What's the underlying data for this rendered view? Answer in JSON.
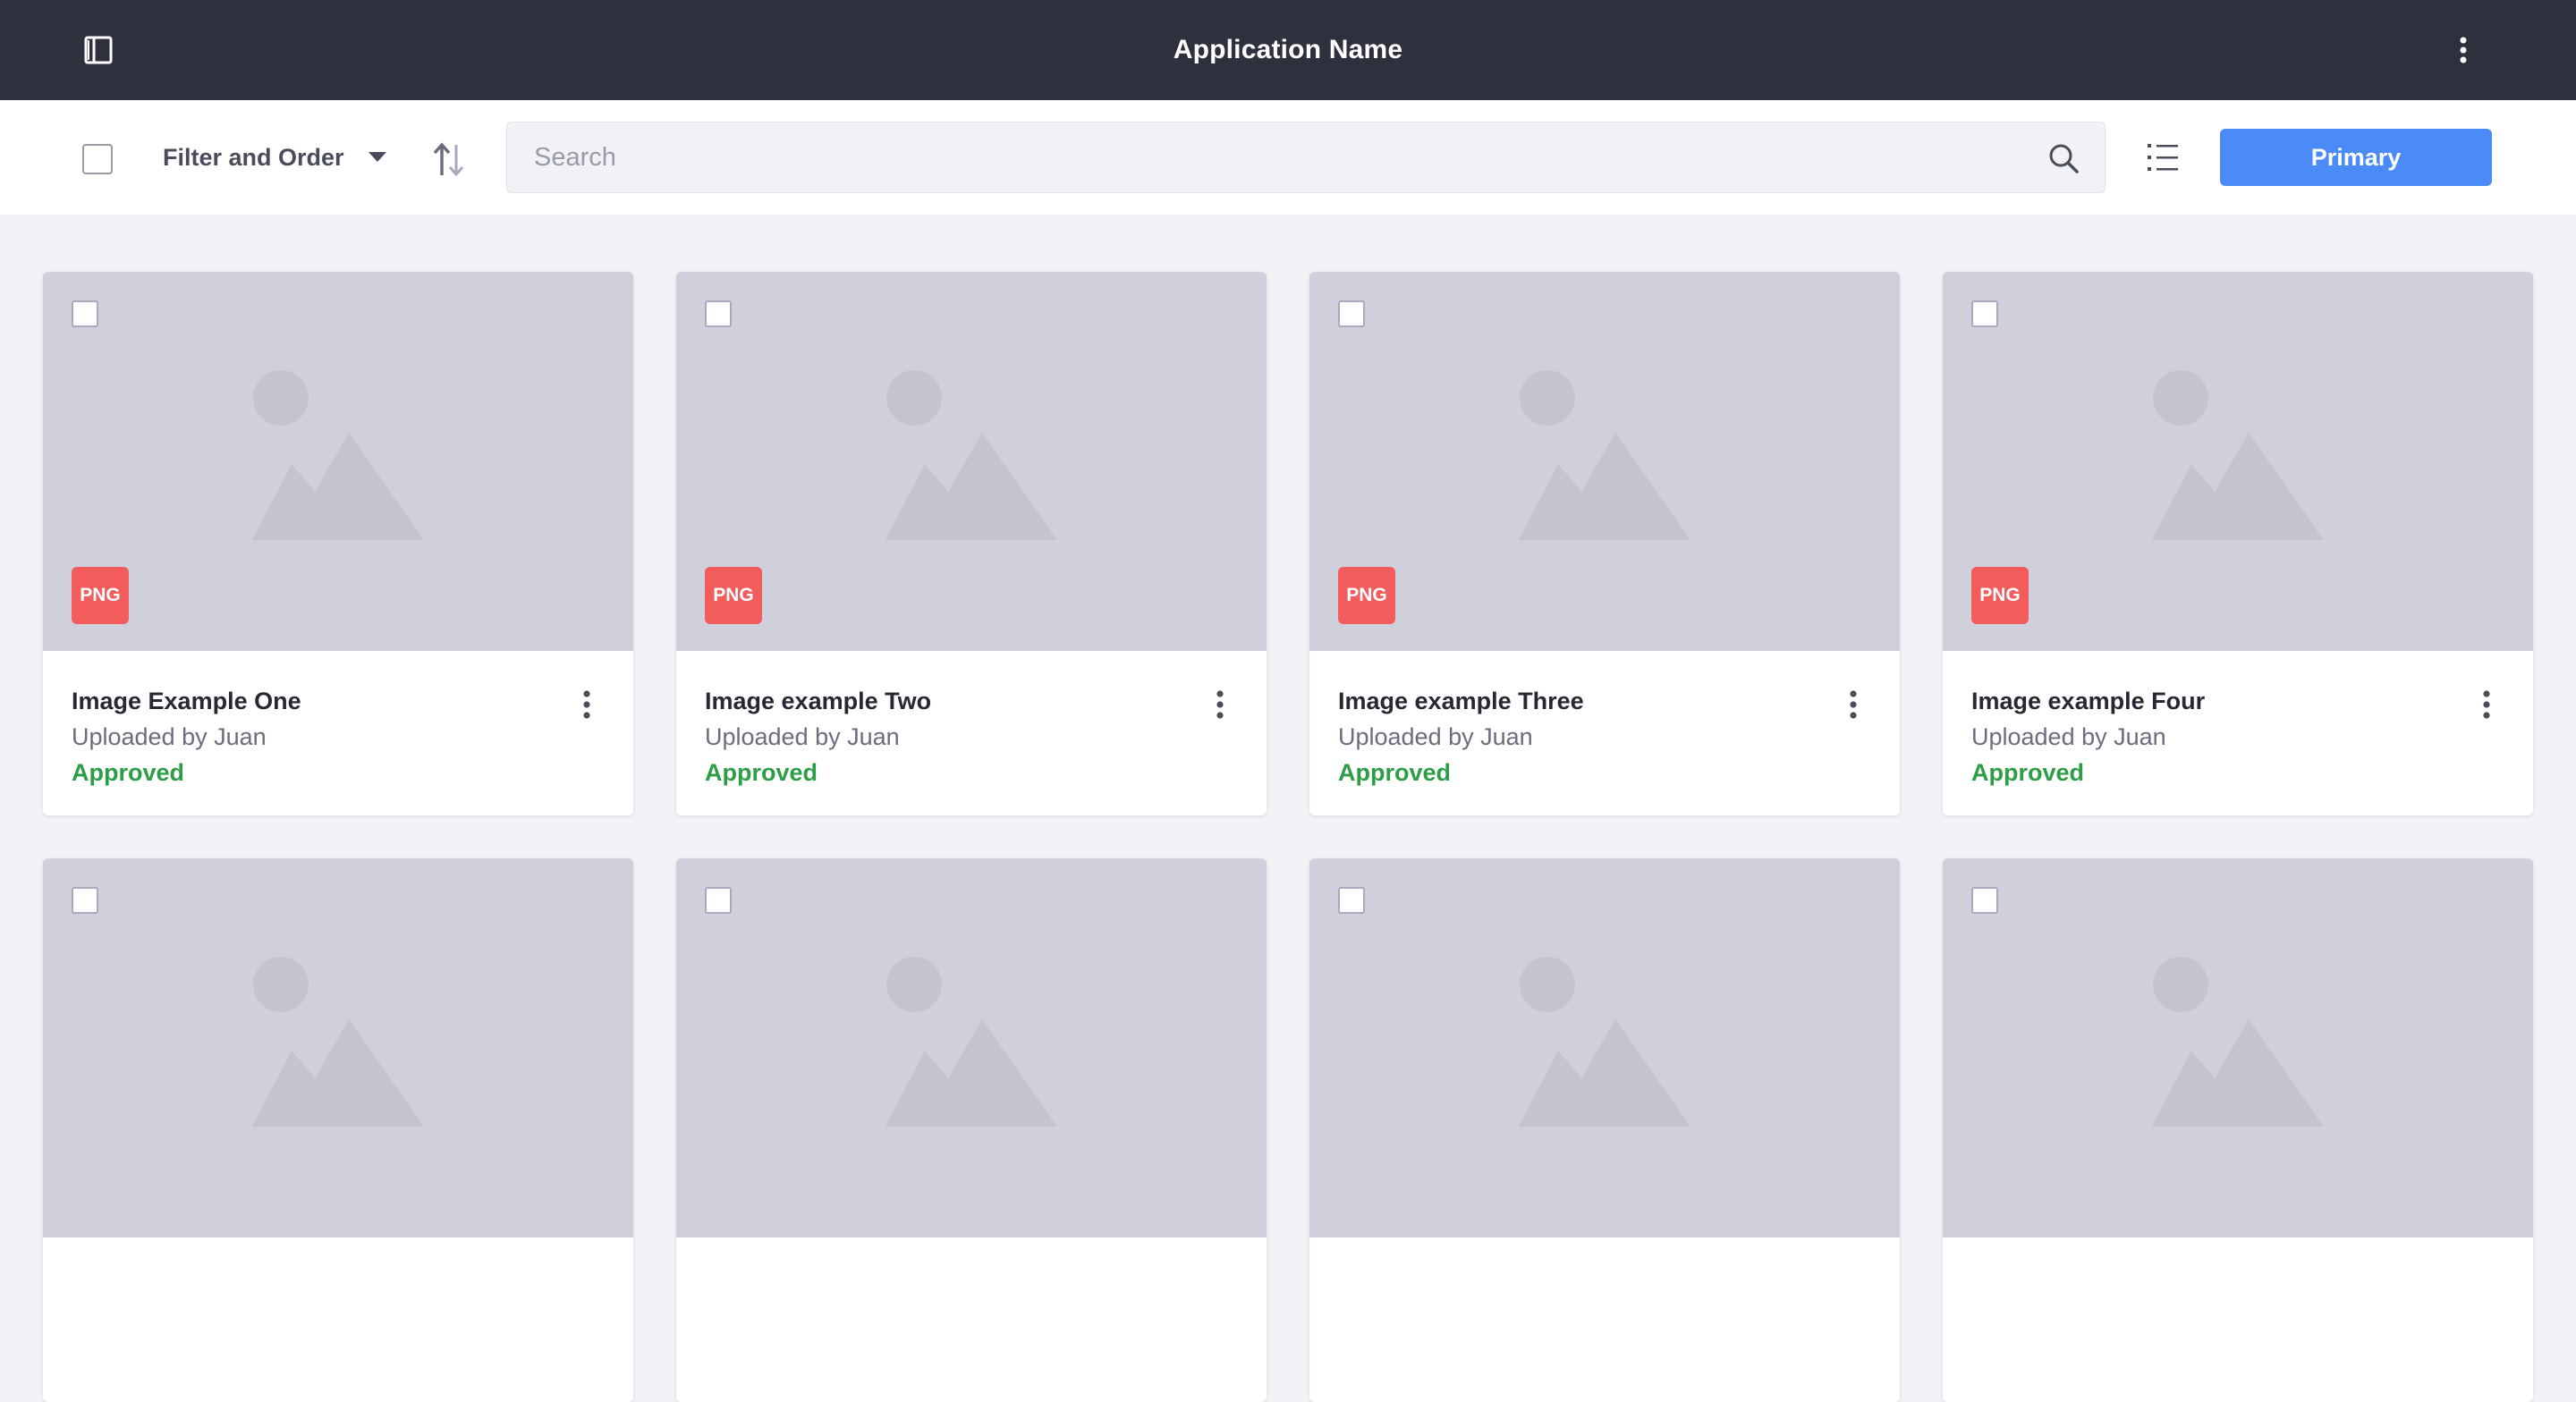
{
  "header": {
    "title": "Application Name",
    "sidebar_toggle_icon": "sidebar-toggle-icon",
    "menu_icon": "kebab-vertical-icon",
    "background": "#2e303d"
  },
  "toolbar": {
    "filter_label": "Filter and Order",
    "filter_icon": "caret-down-icon",
    "sort_icon": "sort-arrows-icon",
    "search": {
      "placeholder": "Search",
      "value": "",
      "icon": "search-icon"
    },
    "view_icon": "list-view-icon",
    "primary_label": "Primary",
    "primary_color": "#4b8bf6"
  },
  "cards": [
    {
      "badge": "PNG",
      "title": "Image Example One",
      "subtitle": "Uploaded by Juan",
      "status": "Approved"
    },
    {
      "badge": "PNG",
      "title": "Image example Two",
      "subtitle": "Uploaded by Juan",
      "status": "Approved"
    },
    {
      "badge": "PNG",
      "title": "Image example Three",
      "subtitle": "Uploaded by Juan",
      "status": "Approved"
    },
    {
      "badge": "PNG",
      "title": "Image example Four",
      "subtitle": "Uploaded by Juan",
      "status": "Approved"
    }
  ],
  "colors": {
    "badge": "#f25c5c",
    "status_approved": "#2e9d48",
    "thumb_background": "#cfd0db",
    "page_background": "#f1f2f5"
  }
}
